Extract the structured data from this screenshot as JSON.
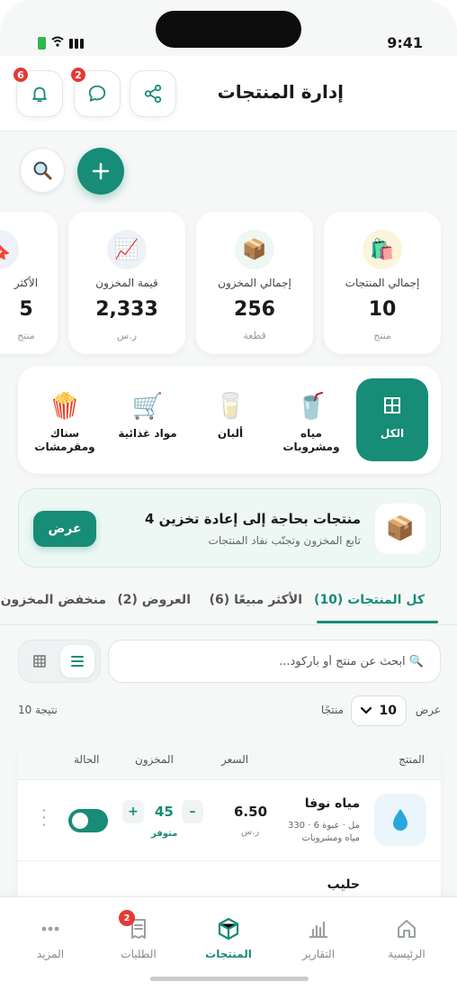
{
  "status_bar": {
    "time": "9:41"
  },
  "header": {
    "title": "إدارة المنتجات",
    "notifications_badge": "6",
    "messages_badge": "2"
  },
  "stats": [
    {
      "label": "إجمالي المنتجات",
      "value": "10",
      "unit": "منتج",
      "icon": "shopping-bags-icon",
      "icon_bg": "#fdf4dc"
    },
    {
      "label": "إجمالي المخزون",
      "value": "256",
      "unit": "قطعة",
      "icon": "box-icon",
      "icon_bg": "#eef7f1"
    },
    {
      "label": "قيمة المخزون",
      "value": "2,333",
      "unit": "ر.س",
      "icon": "chart-icon",
      "icon_bg": "#eef2f8"
    },
    {
      "label": "الأكثر",
      "value": "5",
      "unit": "منتج",
      "icon": "bookmark-icon",
      "icon_bg": "#eef2f8"
    }
  ],
  "categories": [
    {
      "label": "الكل",
      "icon": "grid-icon",
      "active": true
    },
    {
      "label": "مياه ومشروبات",
      "icon": "drink-icon"
    },
    {
      "label": "ألبان",
      "icon": "milk-icon"
    },
    {
      "label": "مواد غذائية",
      "icon": "cart-icon"
    },
    {
      "label": "سناك ومقرمشات",
      "icon": "popcorn-icon"
    }
  ],
  "restock": {
    "title": "4 منتجات بحاجة إلى إعادة تخزين",
    "subtitle": "تابع المخزون وتجنّب نفاد المنتجات",
    "button": "عرض"
  },
  "tabs": [
    {
      "label": "كل المنتجات (10)",
      "active": true
    },
    {
      "label": "الأكثر مبيعًا (6)"
    },
    {
      "label": "العروض (2)"
    },
    {
      "label": "منخفض المخزون"
    }
  ],
  "search": {
    "placeholder": "🔍 ابحث عن منتج أو باركود..."
  },
  "pagination": {
    "show_label": "عرض",
    "per_page": "10",
    "unit": "منتجًا",
    "result_count": "10 نتيجة"
  },
  "table": {
    "headers": {
      "product": "المنتج",
      "price": "السعر",
      "stock": "المخزون",
      "status": "الحالة"
    },
    "rows": [
      {
        "name": "مياه نوفا",
        "meta": "330 مل · عبوة 6 · مياه ومشروبات",
        "price": "6.50",
        "currency": "ر.س",
        "stock": "45",
        "stock_status": "متوفر",
        "active": true
      },
      {
        "name": "حليب"
      }
    ]
  },
  "bottom_nav": [
    {
      "label": "الرئيسية",
      "icon": "home-icon"
    },
    {
      "label": "التقارير",
      "icon": "reports-icon"
    },
    {
      "label": "المنتجات",
      "icon": "products-icon",
      "active": true
    },
    {
      "label": "الطلبات",
      "icon": "orders-icon",
      "badge": "2"
    },
    {
      "label": "المزيد",
      "icon": "more-icon"
    }
  ],
  "colors": {
    "accent": "#178c76",
    "badge": "#e53935"
  }
}
